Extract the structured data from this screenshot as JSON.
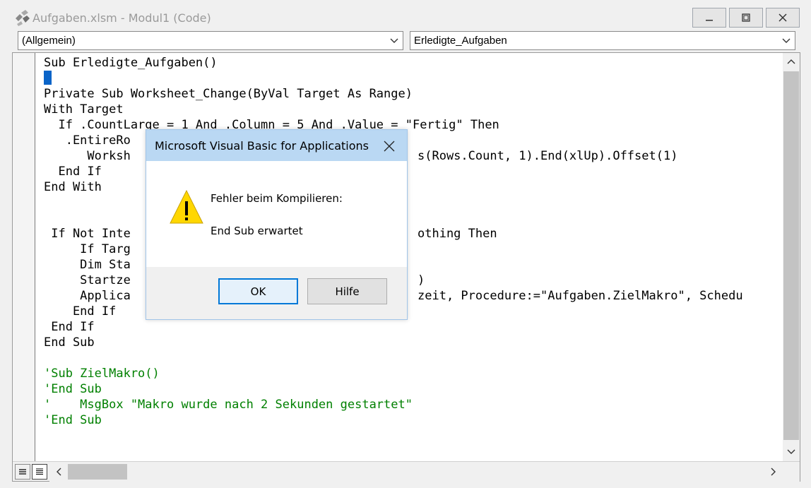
{
  "window": {
    "title": "Aufgaben.xlsm - Modul1 (Code)",
    "icon": "vba-module-icon"
  },
  "object_box": {
    "value": "(Allgemein)"
  },
  "procedure_box": {
    "value": "Erledigte_Aufgaben"
  },
  "code_lines": [
    {
      "text": "Sub Erledigte_Aufgaben()",
      "type": "code"
    },
    {
      "text": "",
      "type": "code"
    },
    {
      "text": "Private Sub Worksheet_Change(ByVal Target As Range)",
      "type": "code"
    },
    {
      "text": "With Target",
      "type": "code"
    },
    {
      "text": "  If .CountLarge = 1 And .Column = 5 And .Value = \"Fertig\" Then",
      "type": "code"
    },
    {
      "text": "   .EntireRo",
      "type": "code"
    },
    {
      "text": "      Worksh",
      "type": "code"
    },
    {
      "text": "  End If",
      "type": "code"
    },
    {
      "text": "End With",
      "type": "code"
    },
    {
      "text": "",
      "type": "code"
    },
    {
      "text": "",
      "type": "code"
    },
    {
      "text": " If Not Inte",
      "type": "code"
    },
    {
      "text": "     If Targ",
      "type": "code"
    },
    {
      "text": "     Dim Sta",
      "type": "code"
    },
    {
      "text": "     Startze",
      "type": "code"
    },
    {
      "text": "     Applica",
      "type": "code"
    },
    {
      "text": "    End If",
      "type": "code"
    },
    {
      "text": " End If",
      "type": "code"
    },
    {
      "text": "End Sub",
      "type": "code"
    },
    {
      "text": "",
      "type": "code"
    },
    {
      "text": "'Sub ZielMakro()",
      "type": "comment"
    },
    {
      "text": "'End Sub",
      "type": "comment"
    },
    {
      "text": "'    MsgBox \"Makro wurde nach 2 Sekunden gestartet\"",
      "type": "comment"
    },
    {
      "text": "'End Sub",
      "type": "comment"
    }
  ],
  "code_fragments": [
    {
      "line": 6,
      "text": "s(Rows.Count, 1).End(xlUp).Offset(1)"
    },
    {
      "line": 11,
      "text": "othing Then"
    },
    {
      "line": 14,
      "text": ")"
    },
    {
      "line": 15,
      "text": "zeit, Procedure:=\"Aufgaben.ZielMakro\", Schedu"
    }
  ],
  "dialog": {
    "title": "Microsoft Visual Basic for Applications",
    "message_heading": "Fehler beim Kompilieren:",
    "message_detail": "End Sub erwartet",
    "ok_label": "OK",
    "help_label": "Hilfe",
    "icon": "warning-icon"
  },
  "colors": {
    "comment": "#008000",
    "cursor": "#0a64c8",
    "dialog_title_bg": "#bad8f3",
    "warning_yellow": "#ffd700"
  }
}
